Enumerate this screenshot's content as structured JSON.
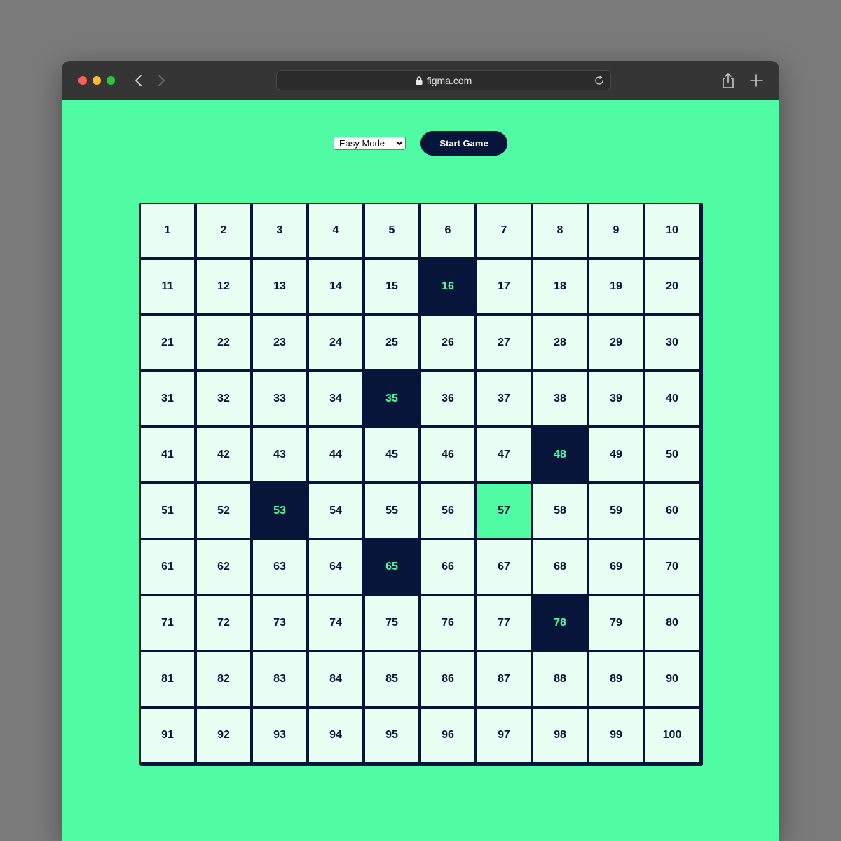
{
  "browser": {
    "url": "figma.com"
  },
  "controls": {
    "mode_options": [
      "Easy Mode"
    ],
    "mode_selected": "Easy Mode",
    "start_label": "Start Game"
  },
  "board": {
    "rows": 10,
    "cols": 10,
    "cells": [
      1,
      2,
      3,
      4,
      5,
      6,
      7,
      8,
      9,
      10,
      11,
      12,
      13,
      14,
      15,
      16,
      17,
      18,
      19,
      20,
      21,
      22,
      23,
      24,
      25,
      26,
      27,
      28,
      29,
      30,
      31,
      32,
      33,
      34,
      35,
      36,
      37,
      38,
      39,
      40,
      41,
      42,
      43,
      44,
      45,
      46,
      47,
      48,
      49,
      50,
      51,
      52,
      53,
      54,
      55,
      56,
      57,
      58,
      59,
      60,
      61,
      62,
      63,
      64,
      65,
      66,
      67,
      68,
      69,
      70,
      71,
      72,
      73,
      74,
      75,
      76,
      77,
      78,
      79,
      80,
      81,
      82,
      83,
      84,
      85,
      86,
      87,
      88,
      89,
      90,
      91,
      92,
      93,
      94,
      95,
      96,
      97,
      98,
      99,
      100
    ],
    "dark_cells": [
      16,
      35,
      48,
      53,
      65,
      78
    ],
    "highlighted_cells": [
      57
    ]
  },
  "colors": {
    "background": "#50fca3",
    "dark": "#07153a",
    "cell": "#e9fff3",
    "accent": "#50fca3"
  },
  "icons": {
    "back": "chevron-left-icon",
    "forward": "chevron-right-icon",
    "lock": "lock-icon",
    "reload": "reload-icon",
    "share": "share-icon",
    "new_tab": "plus-icon"
  }
}
